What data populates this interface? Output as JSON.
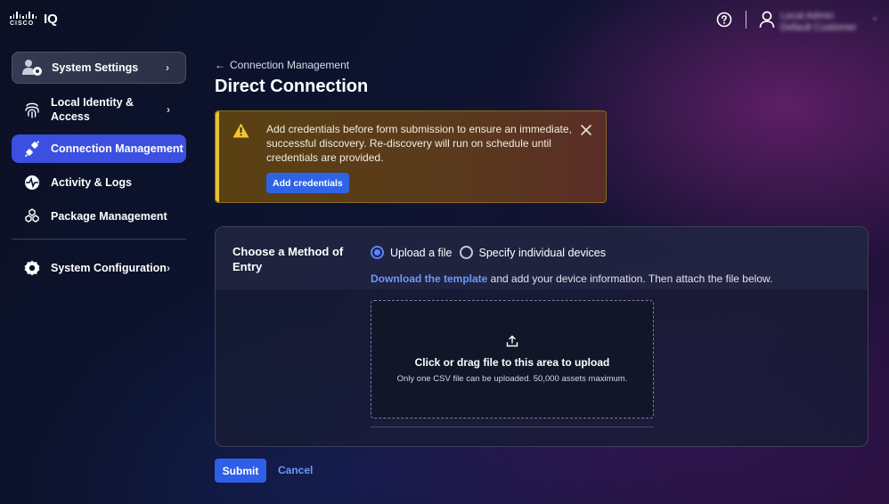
{
  "header": {
    "brand_word": "CISCO",
    "product_name": "IQ",
    "user_name": "Local Admin",
    "user_org": "Default Customer",
    "icons": {
      "help": "help-circle-icon",
      "user": "user-icon",
      "chevron": "chevron-down-icon"
    }
  },
  "sidebar": {
    "items": [
      {
        "label": "System Settings",
        "icon": "system-settings-icon",
        "has_chevron": true
      },
      {
        "label": "Local Identity & Access",
        "icon": "fingerprint-icon",
        "has_chevron": true
      },
      {
        "label": "Connection Management",
        "icon": "plug-icon",
        "active": true
      },
      {
        "label": "Activity & Logs",
        "icon": "pulse-icon"
      },
      {
        "label": "Package Management",
        "icon": "cubes-icon"
      },
      {
        "label": "System Configuration",
        "icon": "gear-icon",
        "has_chevron": true
      }
    ],
    "active_color": "#3b4fe0"
  },
  "main": {
    "back_link": "Connection Management",
    "title": "Direct Connection",
    "alert": {
      "message": "Add credentials before form submission to ensure an immediate, successful discovery. Re-discovery will run on schedule until credentials are provided.",
      "button": "Add credentials",
      "accent_color": "#e8c32a"
    },
    "form": {
      "method_label": "Choose a Method of Entry",
      "options": [
        {
          "label": "Upload a file",
          "checked": true
        },
        {
          "label": "Specify individual devices",
          "checked": false
        }
      ],
      "template_link": "Download the template",
      "template_rest": " and add your device information. Then attach the file below.",
      "dropzone_title": "Click or drag file to this area to upload",
      "dropzone_subtitle": "Only one CSV file can be uploaded. 50,000 assets maximum."
    },
    "actions": {
      "submit": "Submit",
      "cancel": "Cancel"
    }
  },
  "colors": {
    "primary": "#2f5fe8",
    "link": "#6c98ff"
  }
}
